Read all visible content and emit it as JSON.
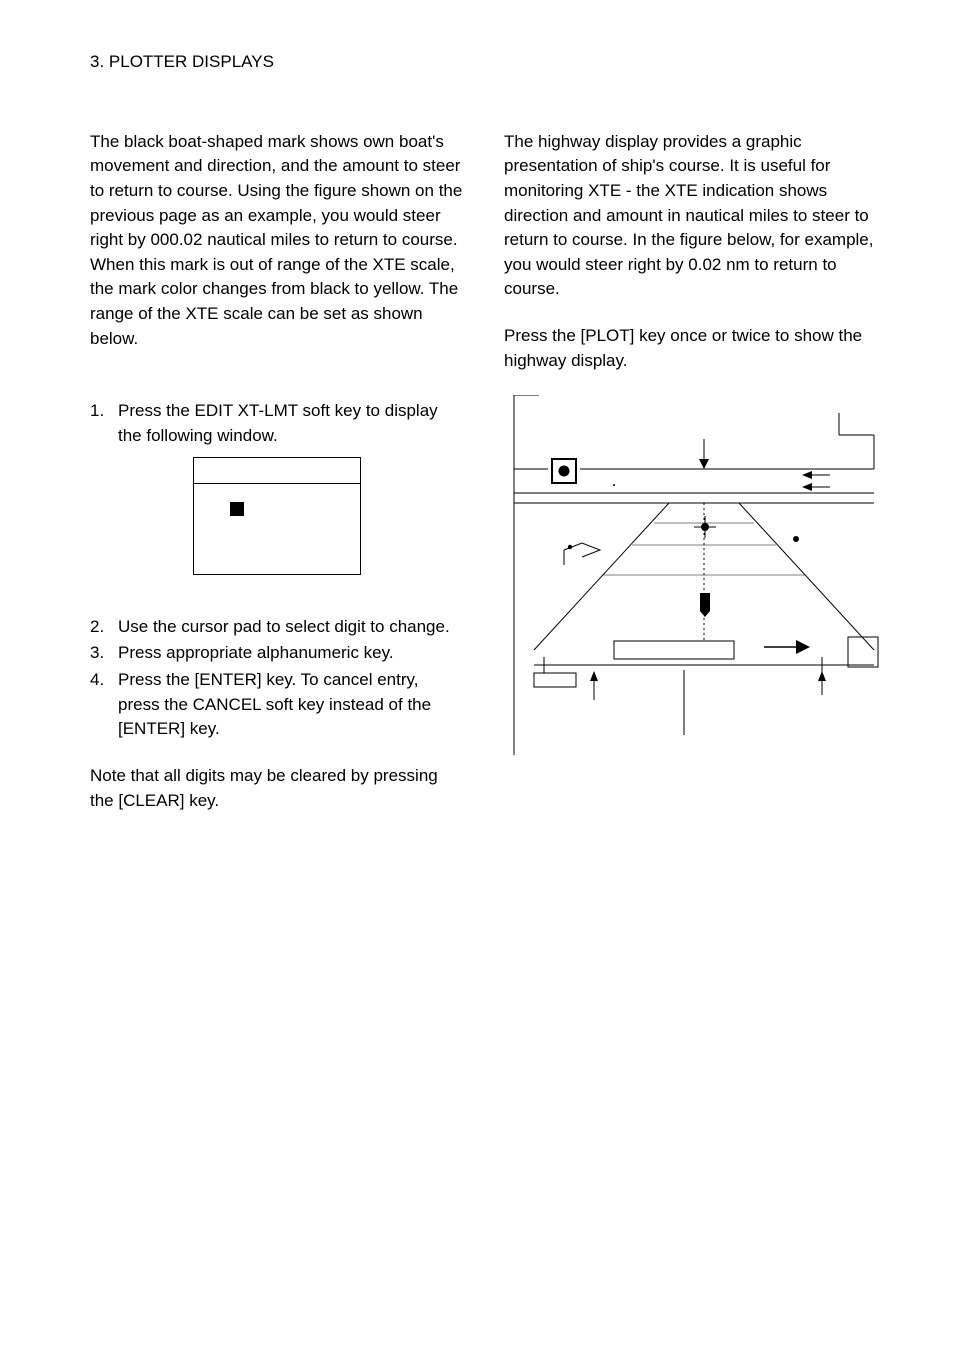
{
  "header": {
    "section": "3. PLOTTER DISPLAYS"
  },
  "leftCol": {
    "p1": "The black boat-shaped mark shows own boat's movement and direction, and the amount to steer to return to course. Using the figure shown on the previous page as an example, you would steer right by 000.02 nautical miles to return to course. When this mark is out of range of the XTE scale, the mark color changes from black to yellow. The range of the XTE scale can be set as shown below.",
    "steps": [
      "Press the EDIT XT-LMT soft key to display the following window.",
      "Use the cursor pad to select digit to change.",
      "Press appropriate alphanumeric key.",
      "Press the [ENTER] key. To cancel entry, press the CANCEL soft key instead of the [ENTER] key."
    ],
    "note": "Note that all digits may be cleared by pressing the [CLEAR] key."
  },
  "rightCol": {
    "p1": "The highway display provides a graphic presentation of ship's course. It is useful for monitoring XTE - the XTE indication shows direction and amount in nautical miles to steer to return to course. In the figure below, for example, you would steer right by 0.02 nm to return to course.",
    "p2": "Press the [PLOT] key once or twice to show the highway display."
  },
  "icons": {
    "boatMark": "boat-icon",
    "waypointMark": "waypoint-icon"
  }
}
